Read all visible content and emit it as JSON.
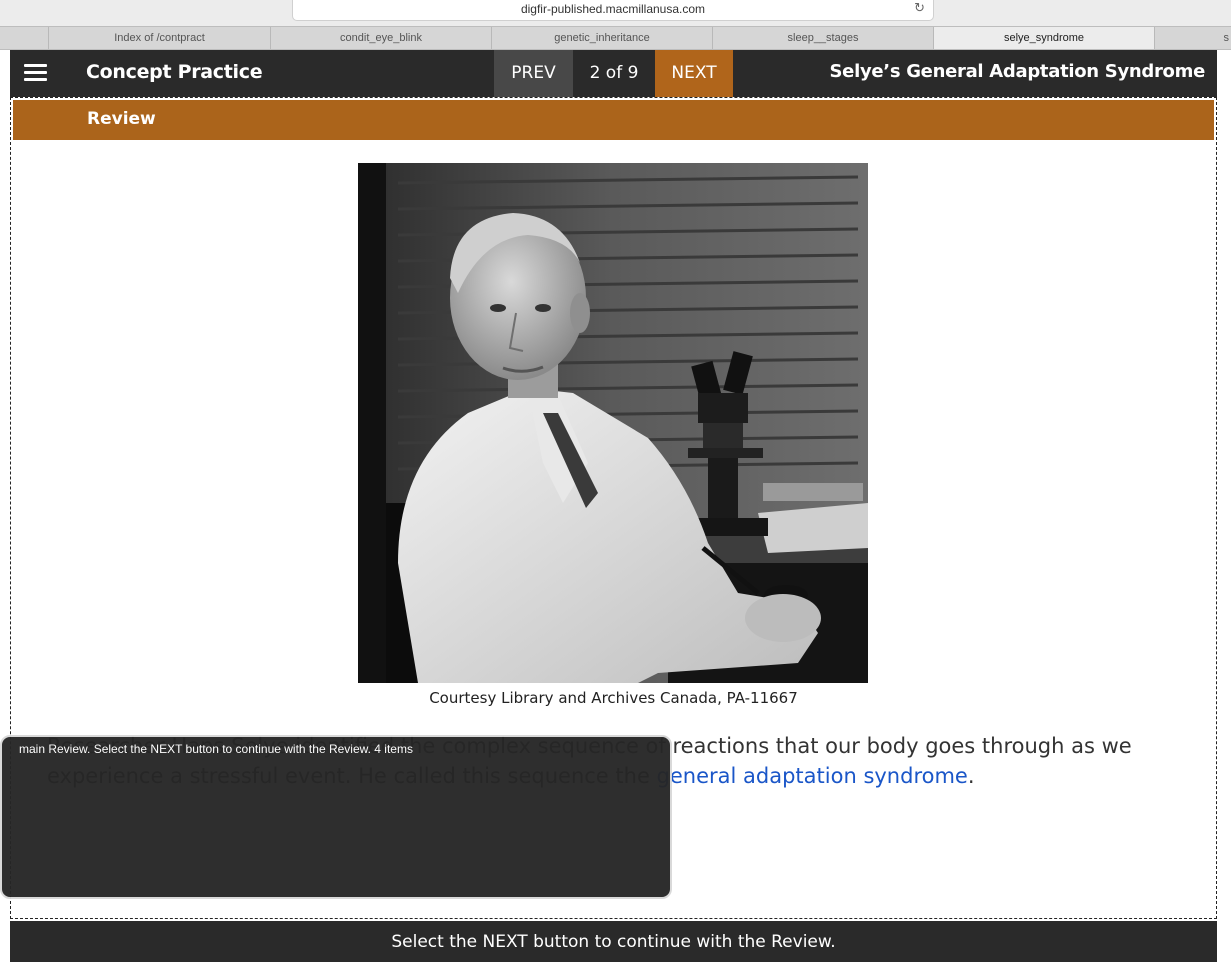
{
  "browser": {
    "url": "digfir-published.macmillanusa.com",
    "reload_icon": "reload-icon",
    "tabs": [
      {
        "label": "Index of /contpract"
      },
      {
        "label": "condit_eye_blink"
      },
      {
        "label": "genetic_inheritance"
      },
      {
        "label": "sleep__stages"
      },
      {
        "label": "selye_syndrome",
        "active": true
      },
      {
        "label": "s"
      }
    ]
  },
  "header": {
    "menu_icon": "hamburger-menu-icon",
    "app_title": "Concept Practice",
    "prev_label": "PREV",
    "page_indicator": "2 of 9",
    "next_label": "NEXT",
    "module_title": "Selye’s General Adaptation Syndrome"
  },
  "section": {
    "label": "Review"
  },
  "figure": {
    "description_icon": "portrait-photo",
    "caption": "Courtesy Library and Archives Canada, PA-11667"
  },
  "body": {
    "text_before": "Researcher Hans Selye identified the complex sequence of reactions that our body goes through as we experience a stressful event. He called this sequence the ",
    "link_text": "general adaptation syndrome",
    "text_after": "."
  },
  "voiceover": {
    "text": "main Review. Select the NEXT button to continue with the Review. 4 items"
  },
  "footer": {
    "text": "Select the NEXT button to continue with the Review."
  },
  "colors": {
    "header_bg": "#2a2a2a",
    "accent_orange": "#ab641b",
    "link_blue": "#1a56c8"
  }
}
